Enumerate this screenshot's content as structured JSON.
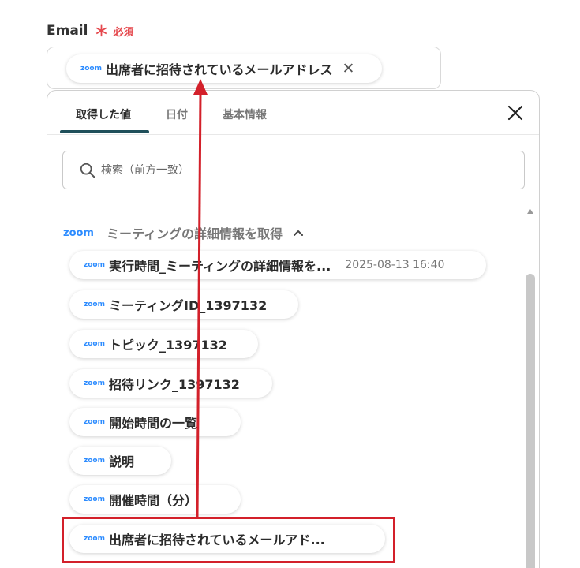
{
  "field": {
    "label": "Email",
    "required_mark": "＊",
    "required_text": "必須",
    "selected_chip": {
      "app": "zoom",
      "text": "出席者に招待されているメールアドレス",
      "remove_glyph": "✕"
    }
  },
  "popup": {
    "tabs": [
      {
        "label": "取得した値",
        "active": true
      },
      {
        "label": "日付",
        "active": false
      },
      {
        "label": "基本情報",
        "active": false
      }
    ],
    "search": {
      "placeholder": "検索（前方一致）"
    },
    "group": {
      "app": "zoom",
      "title": "ミーティングの詳細情報を取得"
    },
    "items": [
      {
        "app": "zoom",
        "text": "実行時間_ミーティングの詳細情報を...",
        "meta": "2025-08-13 16:40"
      },
      {
        "app": "zoom",
        "text": "ミーティングID_1397132"
      },
      {
        "app": "zoom",
        "text": "トピック_1397132"
      },
      {
        "app": "zoom",
        "text": "招待リンク_1397132"
      },
      {
        "app": "zoom",
        "text": "開始時間の一覧"
      },
      {
        "app": "zoom",
        "text": "説明"
      },
      {
        "app": "zoom",
        "text": "開催時間（分）"
      },
      {
        "app": "zoom",
        "text": "出席者に招待されているメールアド..."
      }
    ]
  },
  "colors": {
    "accent_red": "#d3202a",
    "zoom_blue": "#2d8cff",
    "tab_underline": "#1f4f5a"
  }
}
